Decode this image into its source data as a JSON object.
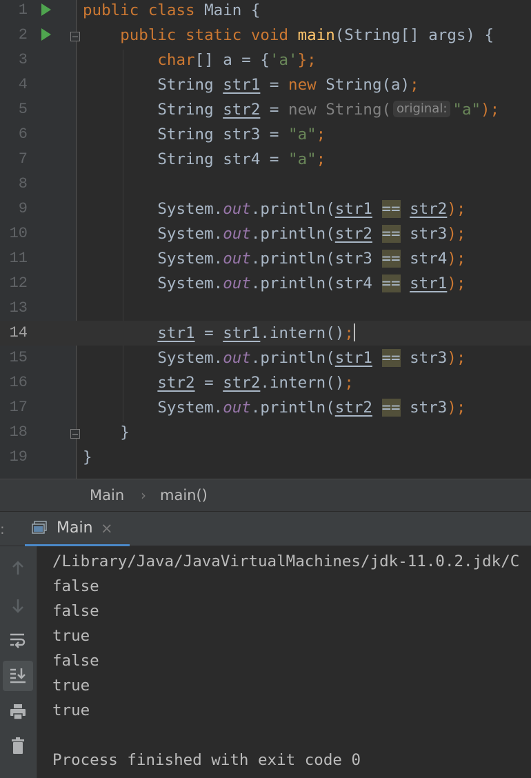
{
  "editor": {
    "line_numbers": [
      "1",
      "2",
      "3",
      "4",
      "5",
      "6",
      "7",
      "8",
      "9",
      "10",
      "11",
      "12",
      "13",
      "14",
      "15",
      "16",
      "17",
      "18",
      "19"
    ],
    "line1": {
      "kw1": "public",
      "kw2": "class",
      "cls": "Main",
      "brace": "{"
    },
    "line2": {
      "kw1": "public",
      "kw2": "static",
      "kw3": "void",
      "method": "main",
      "params": "(String[] args)",
      "brace": "{"
    },
    "line3": {
      "kw": "char",
      "decl": "[] a = {",
      "lit": "'a'",
      "end": "};"
    },
    "line4": {
      "type": "String",
      "var": "str1",
      "eq": " = ",
      "kw": "new",
      "ctor": " String(a)",
      "semi": ";"
    },
    "line5": {
      "type": "String",
      "var": "str2",
      "eq": " = ",
      "kw": "new",
      "ctor": " String(",
      "hint": "original:",
      "lit": "\"a\"",
      "end": ");"
    },
    "line6": {
      "prefix": "String str3 = ",
      "lit": "\"a\"",
      "semi": ";"
    },
    "line7": {
      "prefix": "String str4 = ",
      "lit": "\"a\"",
      "semi": ";"
    },
    "line9": {
      "sys": "System.",
      "out": "out",
      "call": ".println(",
      "a": "str1",
      "op": "==",
      "b": "str2",
      "end": ");"
    },
    "line10": {
      "sys": "System.",
      "out": "out",
      "call": ".println(",
      "a": "str2",
      "op": "==",
      "b": "str3",
      "end": ");"
    },
    "line11": {
      "sys": "System.",
      "out": "out",
      "call": ".println(",
      "a": "str3",
      "op": "==",
      "b": "str4",
      "end": ");"
    },
    "line12": {
      "sys": "System.",
      "out": "out",
      "call": ".println(",
      "a": "str4",
      "op": "==",
      "b": "str1",
      "end": ");"
    },
    "line14": {
      "var": "str1",
      "eq": " = ",
      "var2": "str1",
      "call": ".intern()",
      "semi": ";"
    },
    "line15": {
      "sys": "System.",
      "out": "out",
      "call": ".println(",
      "a": "str1",
      "op": "==",
      "b": "str3",
      "end": ");"
    },
    "line16": {
      "var": "str2",
      "eq": " = ",
      "var2": "str2",
      "call": ".intern()",
      "semi": ";"
    },
    "line17": {
      "sys": "System.",
      "out": "out",
      "call": ".println(",
      "a": "str2",
      "op": "==",
      "b": "str3",
      "end": ");"
    },
    "line18": {
      "brace": "}"
    },
    "line19": {
      "brace": "}"
    }
  },
  "breadcrumb": {
    "class": "Main",
    "separator": "›",
    "method": "main()"
  },
  "run_panel": {
    "colon": ":",
    "tab_label": "Main",
    "tab_close": "×",
    "console_lines": [
      "/Library/Java/JavaVirtualMachines/jdk-11.0.2.jdk/C",
      "false",
      "false",
      "true",
      "false",
      "true",
      "true",
      "",
      "Process finished with exit code 0"
    ]
  },
  "icons": {
    "run": "run-gutter-icon",
    "fold": "fold-icon",
    "toolbar": [
      "arrow-up-icon",
      "arrow-down-icon",
      "soft-wrap-icon",
      "scroll-to-end-icon",
      "print-icon",
      "trash-icon"
    ]
  },
  "colors": {
    "keyword": "#cc7832",
    "method": "#ffc66d",
    "string": "#6a8759",
    "field": "#9876aa",
    "text": "#a9b7c6",
    "run_green": "#4fa54f",
    "tab_accent": "#4a88c7"
  }
}
